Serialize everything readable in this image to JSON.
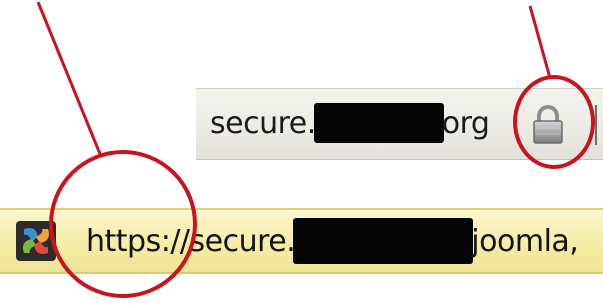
{
  "top_bar": {
    "url_prefix": "secure.",
    "url_suffix": "org",
    "lock_icon": "padlock-icon"
  },
  "address_bar": {
    "url_prefix": "https://secure.",
    "url_suffix": "joomla,",
    "favicon": "joomla-favicon-icon",
    "background_color": "#f6eda8"
  },
  "annotations": {
    "color": "#c8141e"
  }
}
